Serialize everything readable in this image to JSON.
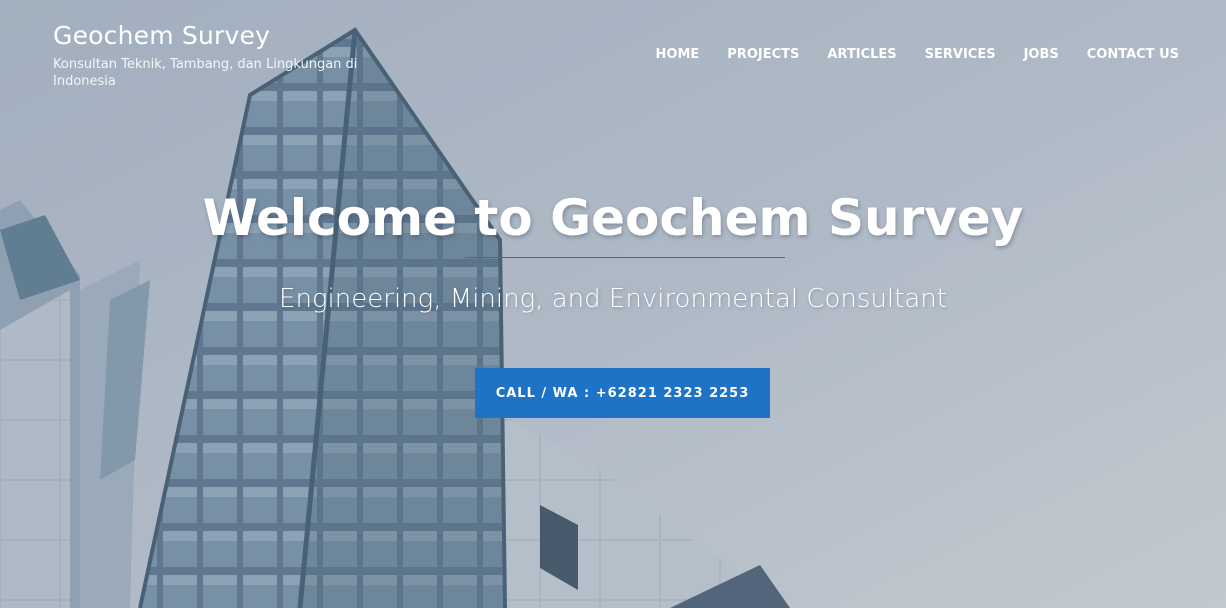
{
  "site": {
    "title": "Geochem Survey",
    "tagline": "Konsultan Teknik, Tambang, dan Lingkungan di Indonesia"
  },
  "nav": {
    "items": [
      {
        "label": "HOME"
      },
      {
        "label": "PROJECTS"
      },
      {
        "label": "ARTICLES"
      },
      {
        "label": "SERVICES"
      },
      {
        "label": "JOBS"
      },
      {
        "label": "CONTACT US"
      }
    ]
  },
  "hero": {
    "title": "Welcome to Geochem Survey",
    "subtitle": "Engineering, Mining, and Environmental Consultant",
    "cta_label": "CALL / WA : +62821 2323 2253"
  },
  "colors": {
    "accent": "#1e73c7",
    "divider": "#2a6fbf",
    "text": "#ffffff"
  }
}
